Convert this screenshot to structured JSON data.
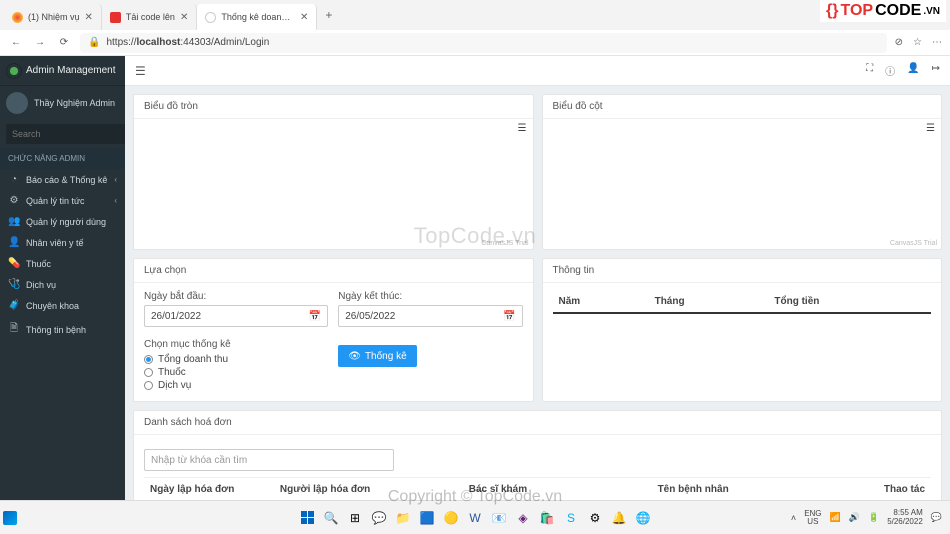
{
  "browser": {
    "tabs": [
      {
        "title": "(1) Nhiệm vụ"
      },
      {
        "title": "Tải code lên"
      },
      {
        "title": "Thống kê doanh thu"
      }
    ],
    "url_prefix": "https://",
    "url_host": "localhost",
    "url_rest": ":44303/Admin/Login"
  },
  "watermark_center": "TopCode.vn",
  "watermark_copyright": "Copyright © TopCode.vn",
  "logo_text_a": "TOP",
  "logo_text_b": "CODE",
  "logo_text_c": ".VN",
  "sidebar": {
    "title": "Admin Management",
    "user": "Thầy Nghiệm Admin",
    "search_ph": "Search",
    "category": "CHỨC NĂNG ADMIN",
    "items": [
      {
        "icon": "◔",
        "label": "Báo cáo & Thống kê",
        "chev": true
      },
      {
        "icon": "⚙",
        "label": "Quản lý tin tức",
        "chev": true
      },
      {
        "icon": "👥",
        "label": "Quản lý người dùng",
        "chev": false
      },
      {
        "icon": "👤",
        "label": "Nhân viên y tế",
        "chev": false
      },
      {
        "icon": "💊",
        "label": "Thuốc",
        "chev": false
      },
      {
        "icon": "🩺",
        "label": "Dịch vụ",
        "chev": false
      },
      {
        "icon": "🧳",
        "label": "Chuyên khoa",
        "chev": false
      },
      {
        "icon": "🗎",
        "label": "Thông tin bệnh",
        "chev": false
      }
    ]
  },
  "panels": {
    "pie_title": "Biểu đồ tròn",
    "bar_title": "Biểu đồ cột",
    "trial": "CanvasJS Trial",
    "options_title": "Lựa chọn",
    "start_label": "Ngày bắt đầu:",
    "end_label": "Ngày kết thúc:",
    "start_value": "26/01/2022",
    "end_value": "26/05/2022",
    "choose_stat": "Chọn mục thống kê",
    "opt1": "Tổng doanh thu",
    "opt2": "Thuốc",
    "opt3": "Dịch vụ",
    "btn_stat": "Thống kê",
    "info_title": "Thông tin",
    "col_year": "Năm",
    "col_month": "Tháng",
    "col_total": "Tổng tiền",
    "invoice_title": "Danh sách hoá đơn",
    "search_ph": "Nhập từ khóa cần tìm",
    "inv_c1": "Ngày lập hóa đơn",
    "inv_c2": "Người lập hóa đơn",
    "inv_c3": "Bác sĩ khám",
    "inv_c4": "Tên bệnh nhân",
    "inv_c5": "Thao tác"
  },
  "taskbar": {
    "lang1": "ENG",
    "lang2": "US",
    "time": "8:55 AM",
    "date": "5/26/2022"
  }
}
